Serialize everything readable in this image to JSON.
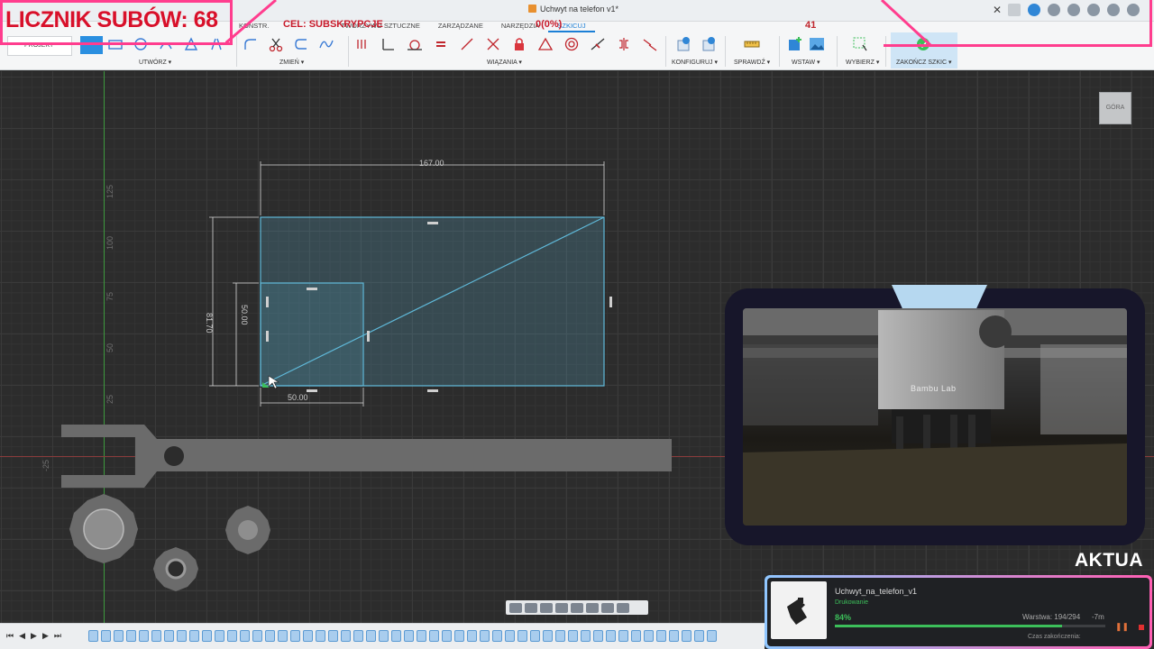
{
  "window": {
    "title": "Uchwyt na telefon v1*",
    "project_label": "PROJEKT"
  },
  "ribbon_tabs": [
    "KONSTR.",
    "TWORZYWO SZTUCZNE",
    "ZARZĄDZANE",
    "NARZĘDZIA",
    "SZKICUJ"
  ],
  "active_tab": "SZKICUJ",
  "ribbon_groups": {
    "create": "UTWÓRZ ▾",
    "modify": "ZMIEŃ ▾",
    "constraints": "WIĄZANIA ▾",
    "configure": "KONFIGURUJ ▾",
    "inspect": "SPRAWDŹ ▾",
    "insert": "WSTAW ▾",
    "select": "WYBIERZ ▾",
    "finish": "ZAKOŃCZ SZKIC ▾"
  },
  "overlay": {
    "sub_counter": "LICZNIK SUBÓW: 68",
    "goal": "CEL: SUBSKRYPCJE",
    "goal_count": "0(0%)",
    "number": "41",
    "ticker": "AKTUA"
  },
  "canvas": {
    "viewcube": "GÓRA",
    "ruler_y": [
      "125",
      "100",
      "75",
      "50",
      "25",
      "-25"
    ],
    "dimensions": {
      "width_total": "167.00",
      "height_total": "81.70",
      "inner_height": "50.00",
      "inner_width": "50.00"
    }
  },
  "camera": {
    "brand": "Bambu Lab"
  },
  "print_status": {
    "file_name": "Uchwyt_na_telefon_v1",
    "state": "Drukowanie",
    "progress_label": "84%",
    "progress": 0.84,
    "layer": "Warstwa: 194/294",
    "remaining": "-7m",
    "finish_label": "Czas zakończenia:"
  },
  "colors": {
    "accent_blue": "#1b7fd6",
    "overlay_pink": "#ff3d8e",
    "overlay_red": "#d8102a",
    "sketch_line": "#5fb8d8",
    "progress_green": "#3cbf5a"
  }
}
